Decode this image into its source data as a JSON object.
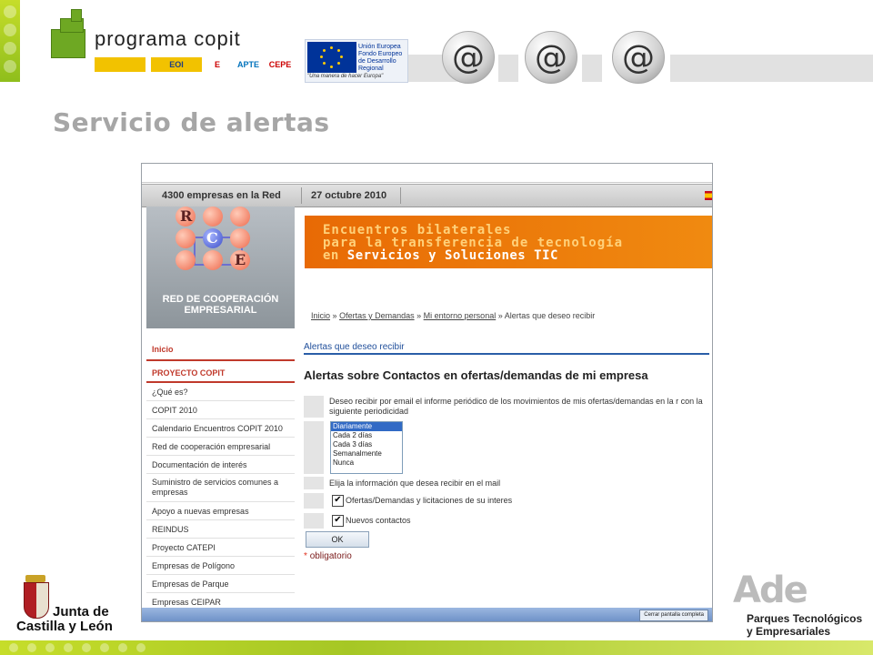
{
  "header": {
    "program_title": "programa copit",
    "sponsor_logos": [
      "ministerio-logo",
      "eoi-logo",
      "enisa-logo",
      "apte-logo",
      "cepe-logo"
    ],
    "sponsor_short": {
      "eoi": "EOI",
      "enisa": "E",
      "apte": "APTE",
      "cepe": "CEPE"
    },
    "eu": {
      "name": "Unión Europea",
      "fund": "Fondo Europeo de Desarrollo Regional",
      "motto": "\"Una manera de hacer Europa\""
    },
    "at_symbol": "@"
  },
  "slide_title": "Servicio de alertas",
  "screenshot": {
    "infobar": {
      "companies": "4300 empresas en la Red",
      "date": "27 octubre 2010"
    },
    "rce": {
      "name": "RED DE COOPERACIÓN EMPRESARIAL",
      "letters": {
        "r": "R",
        "c": "C",
        "e": "E"
      }
    },
    "banner": {
      "line1": "Encuentros bilaterales",
      "line2": "para la transferencia de tecnología",
      "line3_prefix": "en",
      "line3_main": "Servicios y Soluciones TIC"
    },
    "breadcrumb": {
      "items": [
        "Inicio",
        "Ofertas y Demandas",
        "Mi entorno personal",
        "Alertas que deseo recibir"
      ],
      "separator": "»"
    },
    "menu": [
      {
        "label": "Inicio",
        "header": true
      },
      {
        "label": "PROYECTO COPIT",
        "header": true
      },
      {
        "label": "¿Qué es?"
      },
      {
        "label": "COPIT 2010"
      },
      {
        "label": "Calendario Encuentros COPIT 2010"
      },
      {
        "label": "Red de cooperación empresarial"
      },
      {
        "label": "Documentación de interés"
      },
      {
        "label": "Suministro de servicios comunes a empresas"
      },
      {
        "label": "Apoyo a nuevas empresas"
      },
      {
        "label": "REINDUS"
      },
      {
        "label": "Proyecto CATEPI"
      },
      {
        "label": "Empresas de Polígono"
      },
      {
        "label": "Empresas de Parque"
      },
      {
        "label": "Empresas CEIPAR"
      }
    ],
    "section_link": "Alertas que deseo recibir",
    "heading": "Alertas sobre Contactos en ofertas/demandas de mi empresa",
    "periodicity_text": "Deseo recibir por email el informe periódico de los movimientos de mis ofertas/demandas en la r con la siguiente periodicidad",
    "frequency_options": [
      "Diariamente",
      "Cada 2 días",
      "Cada 3 días",
      "Semanalmente",
      "Nunca"
    ],
    "frequency_selected": "Diariamente",
    "info_text": "Elija la información que desea recibir en el mail",
    "checkboxes": [
      {
        "label": "Ofertas/Demandas y licitaciones de su interes",
        "checked": true
      },
      {
        "label": "Nuevos contactos",
        "checked": true
      }
    ],
    "check_mark": "✔",
    "ok_label": "OK",
    "required_mark": "*",
    "required_label": "obligatorio",
    "taskbar_button": "Cerrar pantalla completa"
  },
  "footer": {
    "jcyl_line1": "Junta de",
    "jcyl_line2": "Castilla y León",
    "ade_mark": "Ade",
    "ade_line1": "Parques Tecnológicos",
    "ade_line2": "y Empresariales"
  }
}
